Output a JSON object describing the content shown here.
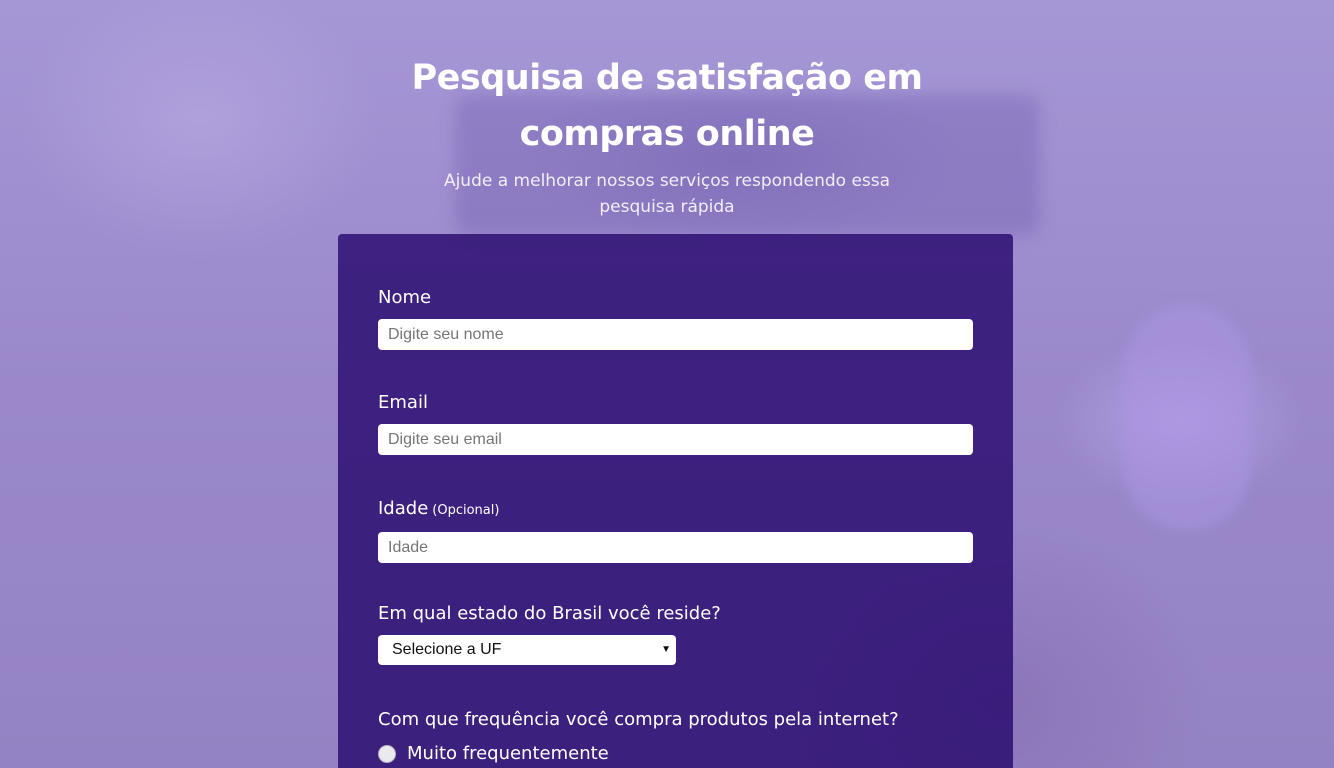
{
  "header": {
    "title": "Pesquisa de satisfação em compras online",
    "subtitle": "Ajude a melhorar nossos serviços respondendo essa pesquisa rápida"
  },
  "form": {
    "name": {
      "label": "Nome",
      "placeholder": "Digite seu nome"
    },
    "email": {
      "label": "Email",
      "placeholder": "Digite seu email"
    },
    "age": {
      "label": "Idade",
      "optional_note": "(Opcional)",
      "placeholder": "Idade"
    },
    "state": {
      "label": "Em qual estado do Brasil você reside?",
      "selected": "Selecione a UF"
    },
    "frequency": {
      "label": "Com que frequência você compra produtos pela internet?",
      "options": [
        "Muito frequentemente"
      ]
    }
  },
  "colors": {
    "background": "#9c89cc",
    "panel": "#280a6e",
    "text": "#ffffff"
  }
}
